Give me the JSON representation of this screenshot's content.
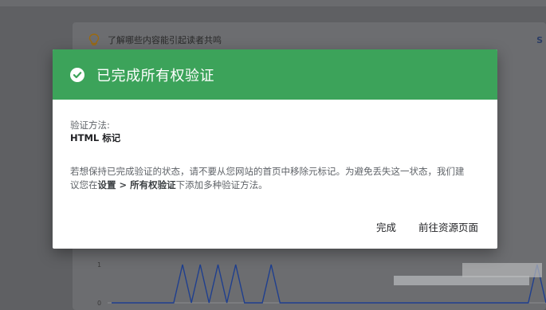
{
  "background": {
    "tip_text": "了解哪些内容能引起读者共鸣",
    "right_label": "S",
    "chart_data": {
      "type": "line",
      "y_ticks": [
        "1",
        "0"
      ],
      "ylim": [
        0,
        1
      ],
      "series": [
        {
          "values": [
            0,
            0,
            0,
            0,
            0,
            0,
            0,
            0,
            1,
            0,
            1,
            0,
            1,
            0,
            1,
            0,
            0,
            0,
            1,
            0,
            0,
            0,
            0,
            0,
            0,
            0,
            0,
            0,
            0,
            0,
            0,
            0,
            0,
            0,
            0,
            0,
            0,
            0,
            0,
            0,
            0,
            0,
            0,
            0,
            0,
            0,
            0,
            0,
            1,
            0
          ]
        }
      ],
      "line_color": "#1f3f8f",
      "grid": false
    }
  },
  "dialog": {
    "title": "已完成所有权验证",
    "header_color": "#3ca35a",
    "method_label": "验证方法:",
    "method_value": "HTML 标记",
    "desc_part1": "若想保持已完成验证的状态，请不要从您网站的首页中移除元标记。为避免丢失这一状态，我们建议您在",
    "desc_bold": "设置 > 所有权验证",
    "desc_part2": "下添加多种验证方法。",
    "btn_done": "完成",
    "btn_goto": "前往资源页面"
  }
}
